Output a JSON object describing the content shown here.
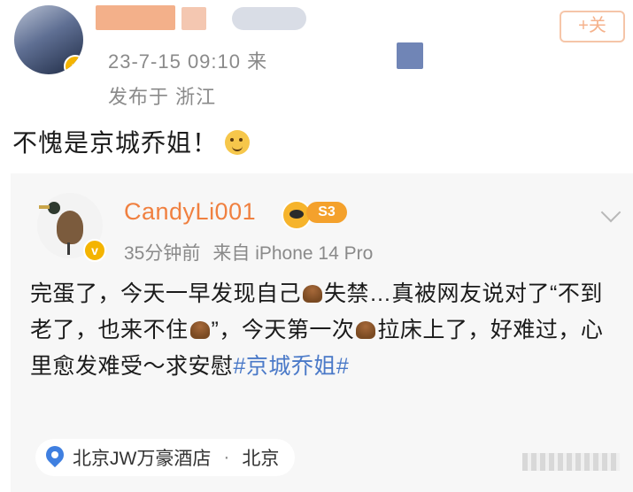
{
  "top_post": {
    "timestamp": "23-7-15 09:10",
    "source_suffix": "来",
    "location": "发布于 浙江",
    "text": "不愧是京城乔姐！"
  },
  "reply": {
    "username": "CandyLi001",
    "level_badge": "S3",
    "time_ago": "35分钟前",
    "device": "来自 iPhone 14 Pro",
    "body_parts": [
      "完蛋了，今天一早发现自己",
      "失禁…真被网友说对了“不到老了，也来不住",
      "”，今天第一次",
      "拉床上了，好难过，心里愈发难受～求安慰"
    ],
    "hashtag": "#京城乔姐#",
    "location_chip": {
      "place": "北京JW万豪酒店",
      "separator": "·",
      "city": "北京"
    }
  },
  "colors": {
    "username": "#f08040",
    "hashtag": "#4a79c8",
    "meta": "#8a8a8a",
    "card_bg": "#f7f7f7"
  },
  "icons": [
    "verified-badge-icon",
    "smile-emoji-icon",
    "vip-icon",
    "chevron-down-icon",
    "poop-emoji-icon",
    "location-pin-icon"
  ]
}
